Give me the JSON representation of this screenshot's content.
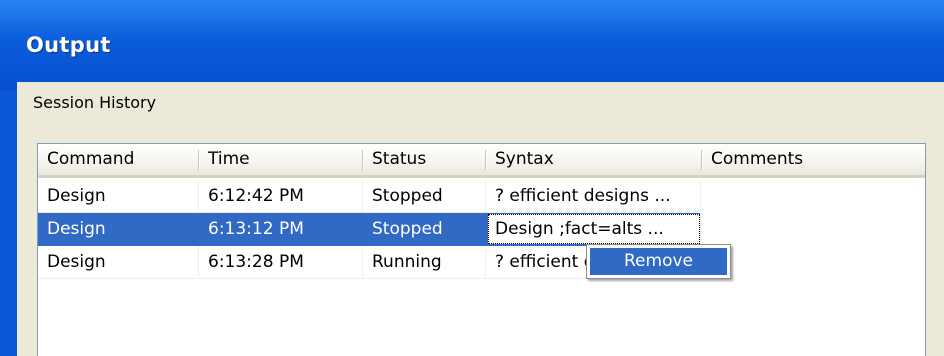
{
  "window": {
    "title": "Output"
  },
  "panel": {
    "label": "Session History"
  },
  "table": {
    "columns": [
      "Command",
      "Time",
      "Status",
      "Syntax",
      "Comments"
    ],
    "rows": [
      {
        "command": "Design",
        "time": "6:12:42 PM",
        "status": "Stopped",
        "syntax": "? efficient designs ...",
        "comments": "",
        "selected": false
      },
      {
        "command": "Design",
        "time": "6:13:12 PM",
        "status": "Stopped",
        "syntax": "Design ;fact=alts ...",
        "comments": "",
        "selected": true
      },
      {
        "command": "Design",
        "time": "6:13:28 PM",
        "status": "Running",
        "syntax": "? efficient designs ...",
        "comments": "",
        "selected": false
      }
    ]
  },
  "context_menu": {
    "items": [
      "Remove"
    ]
  },
  "colors": {
    "titlebar": "#0a5ddc",
    "selection": "#316ac5",
    "client_bg": "#ece9d8"
  }
}
